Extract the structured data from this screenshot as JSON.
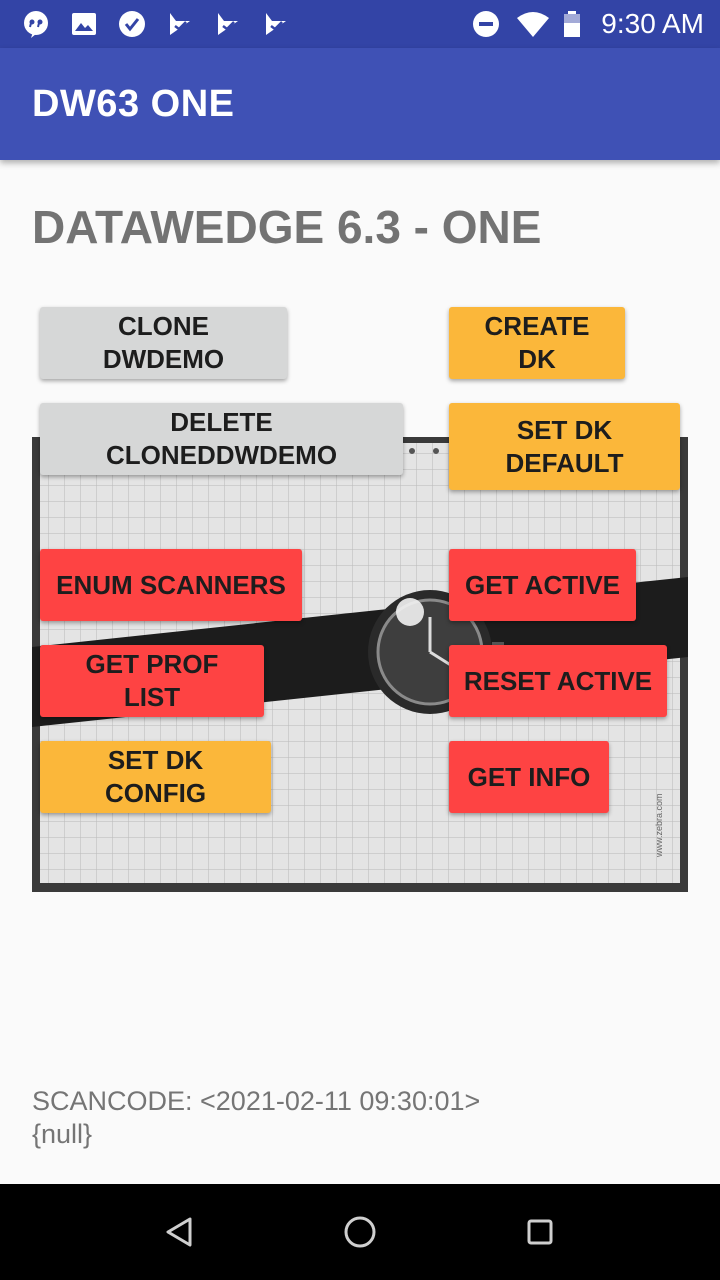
{
  "status_bar": {
    "time": "9:30 AM",
    "left_icons": [
      "quote-notification-icon",
      "image-notification-icon",
      "check-circle-icon",
      "datawedge-icon",
      "datawedge-icon",
      "datawedge-icon"
    ],
    "right_icons": [
      "do-not-disturb-icon",
      "wifi-icon",
      "battery-icon"
    ]
  },
  "app_bar": {
    "title": "DW63 ONE"
  },
  "main": {
    "heading": "DATAWEDGE 6.3 - ONE",
    "buttons": {
      "clone_dwdemo": "CLONE DWDEMO",
      "create_dk": "CREATE DK",
      "delete_cloned": "DELETE CLONEDDWDEMO",
      "set_dk_default": "SET DK\nDEFAULT",
      "enum_scanners": "ENUM SCANNERS",
      "get_active": "GET ACTIVE",
      "get_prof_list": "GET PROF LIST",
      "reset_active": "RESET ACTIVE",
      "set_dk_config": "SET DK CONFIG",
      "get_info": "GET INFO"
    },
    "preview_watermark": "www.zebra.com",
    "scancode_label": "SCANCODE: <2021-02-11 09:30:01>",
    "scancode_value": "{null}"
  },
  "colors": {
    "status_bar": "#3344a6",
    "app_bar": "#3f51b5",
    "button_grey": "#d6d7d7",
    "button_amber": "#fbb73a",
    "button_red": "#fe4343"
  },
  "nav_bar": {
    "icons": [
      "back-icon",
      "home-icon",
      "recents-icon"
    ]
  }
}
